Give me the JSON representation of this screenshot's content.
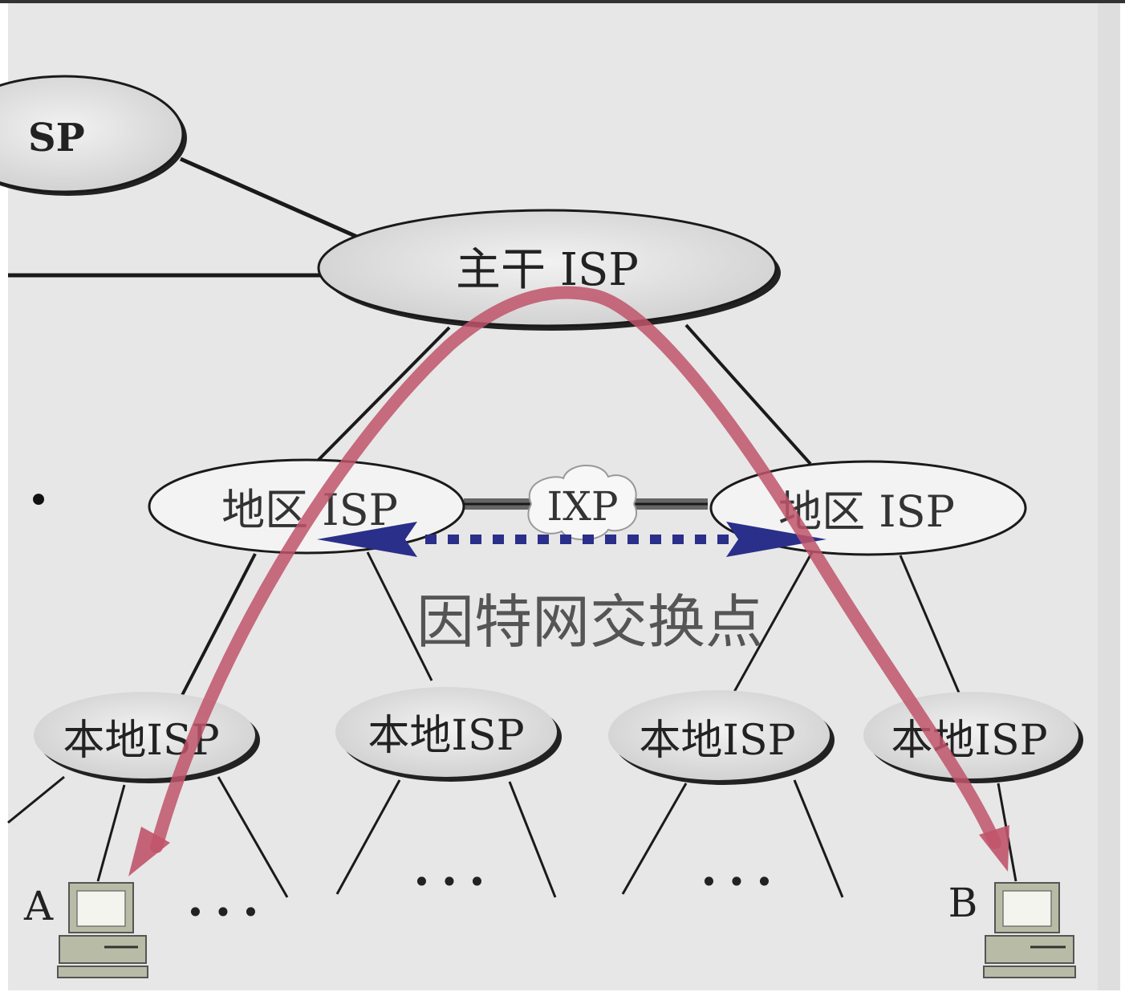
{
  "diagram": {
    "nodes": {
      "backbone_left_partial": {
        "label": "SP"
      },
      "backbone": {
        "label": "主干 ISP"
      },
      "regional_left": {
        "label": "地区 ISP"
      },
      "regional_right": {
        "label": "地区 ISP"
      },
      "ixp": {
        "label": "IXP"
      },
      "local_1": {
        "label": "本地ISP"
      },
      "local_2": {
        "label": "本地ISP"
      },
      "local_3": {
        "label": "本地ISP"
      },
      "local_4": {
        "label": "本地ISP"
      },
      "host_a": {
        "label": "A"
      },
      "host_b": {
        "label": "B"
      }
    },
    "ixp_caption": "因特网交换点",
    "ellipsis": "• • •",
    "bullet": "•"
  },
  "colors": {
    "background": "#e7e7e7",
    "node_fill": "#d7d7d7",
    "node_fill_light": "#eeeeee",
    "edge": "#1a1a1a",
    "path_arrow": "#c0546a",
    "ixp_arrow": "#2a2f8a",
    "computer": "#b8bca6"
  }
}
